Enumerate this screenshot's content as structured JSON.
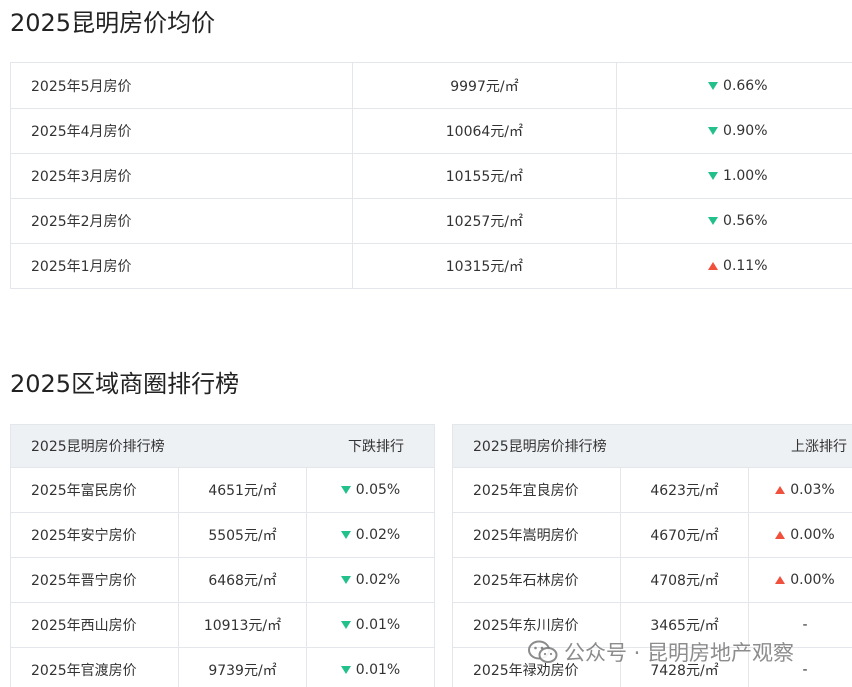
{
  "section1": {
    "title": "2025昆明房价均价",
    "rows": [
      {
        "label": "2025年5月房价",
        "price": "9997元/㎡",
        "trend": "down",
        "change": "0.66%",
        "trend_color": "#22c08a"
      },
      {
        "label": "2025年4月房价",
        "price": "10064元/㎡",
        "trend": "down",
        "change": "0.90%",
        "trend_color": "#22c08a"
      },
      {
        "label": "2025年3月房价",
        "price": "10155元/㎡",
        "trend": "down",
        "change": "1.00%",
        "trend_color": "#22c08a"
      },
      {
        "label": "2025年2月房价",
        "price": "10257元/㎡",
        "trend": "down",
        "change": "0.56%",
        "trend_color": "#22c08a"
      },
      {
        "label": "2025年1月房价",
        "price": "10315元/㎡",
        "trend": "up",
        "change": "0.11%",
        "trend_color": "#f0503c"
      }
    ]
  },
  "section2": {
    "title": "2025区域商圈排行榜",
    "left": {
      "header_title": "2025昆明房价排行榜",
      "header_sort": "下跌排行",
      "rows": [
        {
          "label": "2025年富民房价",
          "price": "4651元/㎡",
          "trend": "down",
          "change": "0.05%"
        },
        {
          "label": "2025年安宁房价",
          "price": "5505元/㎡",
          "trend": "down",
          "change": "0.02%"
        },
        {
          "label": "2025年晋宁房价",
          "price": "6468元/㎡",
          "trend": "down",
          "change": "0.02%"
        },
        {
          "label": "2025年西山房价",
          "price": "10913元/㎡",
          "trend": "down",
          "change": "0.01%"
        },
        {
          "label": "2025年官渡房价",
          "price": "9739元/㎡",
          "trend": "down",
          "change": "0.01%"
        }
      ]
    },
    "right": {
      "header_title": "2025昆明房价排行榜",
      "header_sort": "上涨排行",
      "rows": [
        {
          "label": "2025年宜良房价",
          "price": "4623元/㎡",
          "trend": "up",
          "change": "0.03%"
        },
        {
          "label": "2025年嵩明房价",
          "price": "4670元/㎡",
          "trend": "up",
          "change": "0.00%"
        },
        {
          "label": "2025年石林房价",
          "price": "4708元/㎡",
          "trend": "up",
          "change": "0.00%"
        },
        {
          "label": "2025年东川房价",
          "price": "3465元/㎡",
          "trend": "none",
          "change": "-"
        },
        {
          "label": "2025年禄劝房价",
          "price": "7428元/㎡",
          "trend": "none",
          "change": "-"
        }
      ]
    }
  },
  "watermark": {
    "icon": "wechat-icon",
    "text": "公众号 · 昆明房地产观察"
  },
  "colors": {
    "down": "#22c08a",
    "up": "#f0503c",
    "header_bg": "#eef1f4",
    "border": "#e3e6ea"
  }
}
